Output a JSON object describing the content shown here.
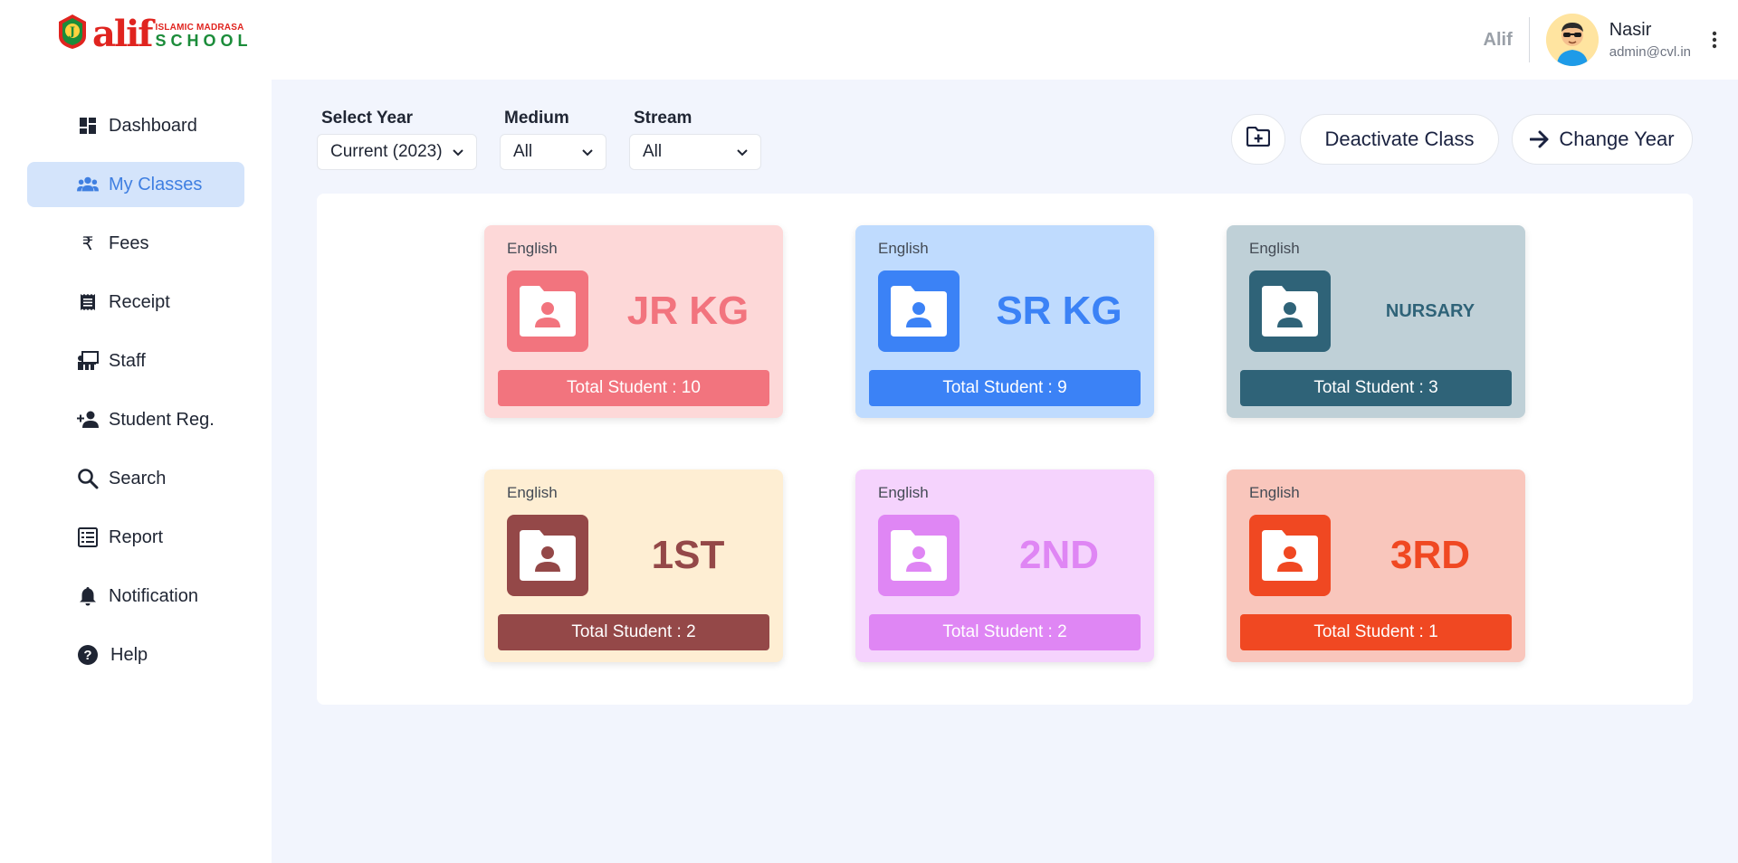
{
  "header": {
    "logo": {
      "line1": "ISLAMIC MADRASA",
      "line2": "SCHOOL",
      "word": "alif"
    },
    "school_name": "Alif",
    "user": {
      "name": "Nasir",
      "email": "admin@cvl.in"
    }
  },
  "sidebar": {
    "items": [
      {
        "label": "Dashboard",
        "icon": "dashboard-icon",
        "active": false
      },
      {
        "label": "My Classes",
        "icon": "people-icon",
        "active": true
      },
      {
        "label": "Fees",
        "icon": "rupee-icon",
        "active": false
      },
      {
        "label": "Receipt",
        "icon": "receipt-icon",
        "active": false
      },
      {
        "label": "Staff",
        "icon": "staff-icon",
        "active": false
      },
      {
        "label": "Student Reg.",
        "icon": "person-add-icon",
        "active": false
      },
      {
        "label": "Search",
        "icon": "search-icon",
        "active": false
      },
      {
        "label": "Report",
        "icon": "report-icon",
        "active": false
      },
      {
        "label": "Notification",
        "icon": "bell-icon",
        "active": false
      },
      {
        "label": "Help",
        "icon": "help-icon",
        "active": false
      }
    ]
  },
  "filters": {
    "year": {
      "label": "Select Year",
      "value": "Current (2023)"
    },
    "medium": {
      "label": "Medium",
      "value": "All"
    },
    "stream": {
      "label": "Stream",
      "value": "All"
    }
  },
  "actions": {
    "add_folder_icon": "create-folder-icon",
    "deactivate_label": "Deactivate Class",
    "change_year_label": "Change Year"
  },
  "classes": [
    {
      "medium": "English",
      "name": "JR KG",
      "total": "Total Student : 10",
      "bg": "#fdd8d8",
      "accent": "#f2747e"
    },
    {
      "medium": "English",
      "name": "SR KG",
      "total": "Total Student : 9",
      "bg": "#bfdbfe",
      "accent": "#3b82f6"
    },
    {
      "medium": "English",
      "name": "NURSARY",
      "total": "Total Student : 3",
      "bg": "#bfd0d7",
      "accent": "#2f6378"
    },
    {
      "medium": "English",
      "name": "1ST",
      "total": "Total Student : 2",
      "bg": "#feeed3",
      "accent": "#944848"
    },
    {
      "medium": "English",
      "name": "2ND",
      "total": "Total Student : 2",
      "bg": "#f5d3fd",
      "accent": "#df86f4"
    },
    {
      "medium": "English",
      "name": "3RD",
      "total": "Total Student : 1",
      "bg": "#f9c6bc",
      "accent": "#f04822"
    }
  ]
}
